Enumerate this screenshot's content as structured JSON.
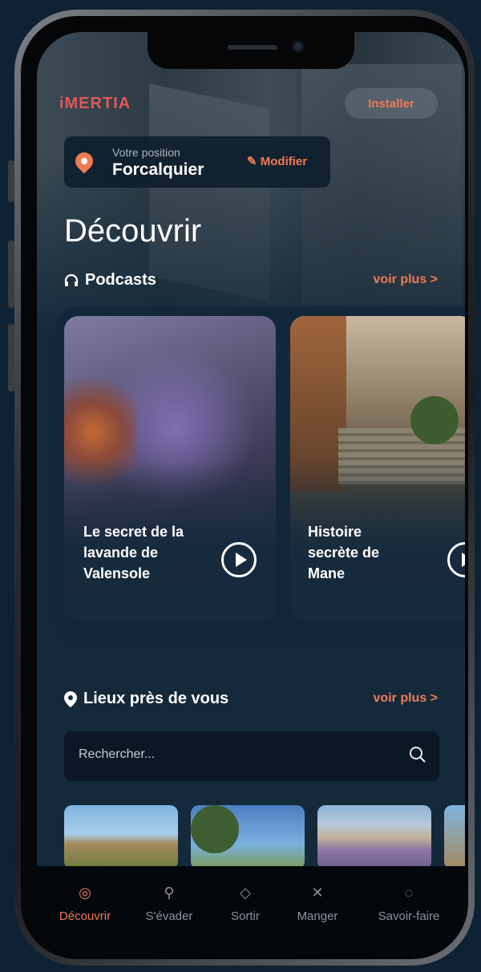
{
  "brand": {
    "logo": "iMERTIA",
    "accent": "#f07a55"
  },
  "header": {
    "install_label": "Installer"
  },
  "location": {
    "label": "Votre position",
    "city": "Forcalquier",
    "modify_label": "Modifier"
  },
  "page": {
    "title": "Découvrir"
  },
  "podcasts": {
    "heading": "Podcasts",
    "see_more": "voir plus >",
    "items": [
      {
        "title": "Le secret de la lavande de Valensole"
      },
      {
        "title": "Histoire secrète de Mane"
      }
    ]
  },
  "places": {
    "heading": "Lieux près de vous",
    "see_more": "voir plus >",
    "search_placeholder": "Rechercher..."
  },
  "tabs": [
    {
      "label": "Découvrir",
      "icon": "compass-icon",
      "active": true
    },
    {
      "label": "S'évader",
      "icon": "hiker-icon",
      "active": false
    },
    {
      "label": "Sortir",
      "icon": "ticket-icon",
      "active": false
    },
    {
      "label": "Manger",
      "icon": "cutlery-icon",
      "active": false
    },
    {
      "label": "Savoir-faire",
      "icon": "handshake-icon",
      "active": false
    }
  ]
}
